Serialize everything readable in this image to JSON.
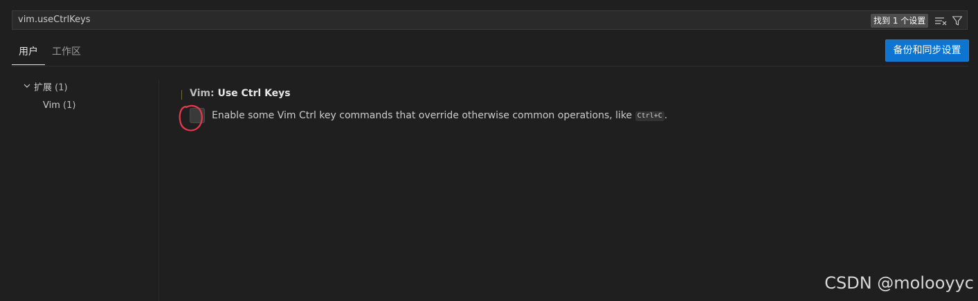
{
  "search": {
    "value": "vim.useCtrlKeys",
    "results_badge": "找到 1 个设置"
  },
  "tabs": [
    {
      "label": "用户",
      "active": true
    },
    {
      "label": "工作区",
      "active": false
    }
  ],
  "sync_button": "备份和同步设置",
  "toc": {
    "group": {
      "label": "扩展",
      "count": "(1)"
    },
    "items": [
      {
        "label": "Vim",
        "count": "(1)"
      }
    ]
  },
  "setting": {
    "category": "Vim: ",
    "title": "Use Ctrl Keys",
    "checked": false,
    "description_prefix": "Enable some Vim Ctrl key commands that override otherwise common operations, like ",
    "description_kbd": "Ctrl+C",
    "description_suffix": "."
  },
  "watermark": "CSDN @molooyyc",
  "colors": {
    "background": "#1f1f1f",
    "accent": "#0e74d1",
    "annotation_circle": "#e8384f"
  },
  "icons": {
    "clear": "clear-filter-icon",
    "filter": "filter-icon",
    "chevron": "chevron-down-icon"
  }
}
